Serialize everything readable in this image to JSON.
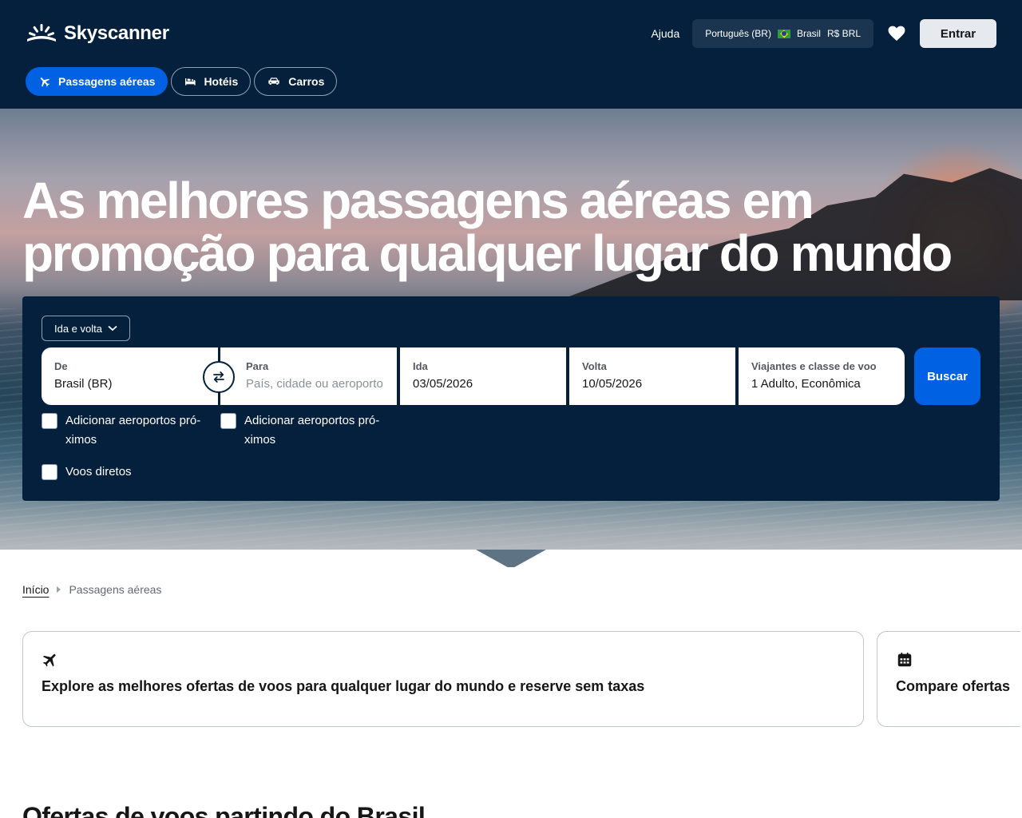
{
  "header": {
    "brand": "Skyscanner",
    "help_label": "Ajuda",
    "locale": {
      "language": "Português (BR)",
      "country": "Brasil",
      "currency": "R$ BRL"
    },
    "login_label": "Entrar",
    "tabs": [
      {
        "label": "Passagens aéreas",
        "icon": "plane-icon",
        "active": true
      },
      {
        "label": "Hotéis",
        "icon": "bed-icon",
        "active": false
      },
      {
        "label": "Carros",
        "icon": "car-icon",
        "active": false
      }
    ]
  },
  "hero": {
    "title": "As melhores passagens aéreas em promoção para qualquer lugar do mundo"
  },
  "search": {
    "trip_type": "Ida e volta",
    "from": {
      "label": "De",
      "value": "Brasil (BR)"
    },
    "to": {
      "label": "Para",
      "placeholder": "País, cidade ou aeroporto"
    },
    "depart": {
      "label": "Ida",
      "value": "03/05/2026"
    },
    "return": {
      "label": "Volta",
      "value": "10/05/2026"
    },
    "travellers": {
      "label": "Viajantes e classe de voo",
      "value": "1 Adulto, Econômica"
    },
    "search_label": "Buscar",
    "nearby_from_label": "Adicionar aeroportos pró-ximos",
    "nearby_to_label": "Adicionar aeroportos pró-ximos",
    "direct_label": "Voos diretos"
  },
  "breadcrumb": {
    "home": "Início",
    "current": "Passagens aéreas"
  },
  "cards": [
    {
      "icon": "plane-icon",
      "text": "Explore as melhores ofertas de voos para qualquer lugar do mundo e reserve sem taxas"
    },
    {
      "icon": "calendar-icon",
      "text": "Compare ofertas"
    }
  ],
  "section": {
    "title": "Ofertas de voos partindo do Brasil"
  },
  "colors": {
    "navy": "#05203c",
    "primary_blue": "#0062e3"
  }
}
